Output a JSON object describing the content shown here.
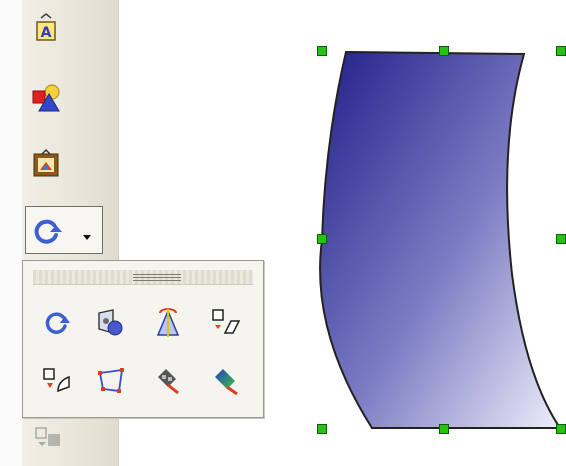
{
  "toolbar": {
    "tools": [
      {
        "name": "fontwork-gallery",
        "icon": "fontwork-A-icon",
        "letter": "A"
      },
      {
        "name": "basic-shapes",
        "icon": "shapes-icon"
      },
      {
        "name": "image-frame",
        "icon": "framed-picture-icon"
      }
    ],
    "dropdown": {
      "icon": "rotate-icon",
      "arrow_icon": "dropdown-arrow-icon",
      "expanded": true
    }
  },
  "popup": {
    "tools": [
      {
        "name": "rotate",
        "icon": "rotate-icon"
      },
      {
        "name": "flip",
        "icon": "flip-icon"
      },
      {
        "name": "in-3d-rotation-object",
        "icon": "3d-rotation-icon"
      },
      {
        "name": "set-in-circle-perspective",
        "icon": "set-in-circle-perspective-icon"
      },
      {
        "name": "set-in-circle-slant",
        "icon": "set-in-circle-slant-icon"
      },
      {
        "name": "distort",
        "icon": "distort-icon"
      },
      {
        "name": "transparency",
        "icon": "transparency-icon"
      },
      {
        "name": "gradient",
        "icon": "gradient-icon"
      }
    ]
  },
  "canvas": {
    "shape": {
      "fill_start": "#20208a",
      "fill_end": "#eeeefa",
      "handles_color": "#27c213"
    }
  },
  "colors": {
    "toolbar_bg": "#ebe8dc",
    "popup_bg": "#f5f4ef",
    "accent_blue": "#3d5fd3"
  }
}
